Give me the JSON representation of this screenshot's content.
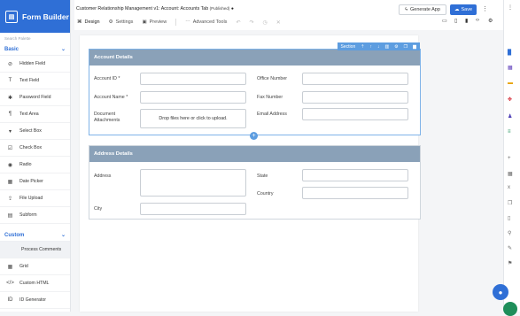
{
  "brand": {
    "title": "Form Builder"
  },
  "sidebar": {
    "search_placeholder": "Search Palette",
    "basic_label": "Basic",
    "basic_items": [
      {
        "label": "Hidden Field",
        "icon": "eye-slash-icon",
        "glyph": "⊘"
      },
      {
        "label": "Text Field",
        "icon": "text-field-icon",
        "glyph": "T"
      },
      {
        "label": "Password Field",
        "icon": "asterisk-icon",
        "glyph": "✱"
      },
      {
        "label": "Text Area",
        "icon": "text-area-icon",
        "glyph": "¶"
      },
      {
        "label": "Select Box",
        "icon": "select-box-icon",
        "glyph": "▾"
      },
      {
        "label": "Check Box",
        "icon": "checkbox-icon",
        "glyph": "☑"
      },
      {
        "label": "Radio",
        "icon": "radio-icon",
        "glyph": "◉"
      },
      {
        "label": "Date Picker",
        "icon": "calendar-icon",
        "glyph": "▦"
      },
      {
        "label": "File Upload",
        "icon": "upload-icon",
        "glyph": "⇪"
      },
      {
        "label": "Subform",
        "icon": "subform-icon",
        "glyph": "▤"
      }
    ],
    "custom_label": "Custom",
    "custom_items": [
      {
        "label": "Process Comments",
        "icon": "",
        "glyph": ""
      },
      {
        "label": "Grid",
        "icon": "grid-icon",
        "glyph": "▦"
      },
      {
        "label": "Custom HTML",
        "icon": "code-icon",
        "glyph": "</>"
      },
      {
        "label": "ID Generator",
        "icon": "id-icon",
        "glyph": "ID"
      }
    ]
  },
  "header": {
    "title": "Customer Relationship Management v1: Account: Accounts Tab",
    "status": "(Published)",
    "tabs": [
      {
        "label": "Design",
        "icon": "design-icon",
        "glyph": "⌘"
      },
      {
        "label": "Settings",
        "icon": "gear-icon",
        "glyph": "⚙"
      },
      {
        "label": "Preview",
        "icon": "preview-icon",
        "glyph": "▣"
      }
    ],
    "advanced_tools": "Advanced Tools",
    "generate_app": "Generate App",
    "save": "Save"
  },
  "sections": [
    {
      "title": "Account Details",
      "toolbar_label": "Section",
      "fields": [
        {
          "label": "Account ID *"
        },
        {
          "label": "Account Name *"
        },
        {
          "label": "Document Attachments"
        },
        {
          "label": "Office Number"
        },
        {
          "label": "Fax Number"
        },
        {
          "label": "Email Address"
        }
      ],
      "drop_text": "Drop files here or click to upload."
    },
    {
      "title": "Address Details",
      "fields": [
        {
          "label": "Address"
        },
        {
          "label": "City"
        },
        {
          "label": "State"
        },
        {
          "label": "Country"
        }
      ]
    }
  ],
  "colors": {
    "accent": "#2f6fd6",
    "section_header": "#8aa1b8",
    "selected": "#5d9de0"
  }
}
